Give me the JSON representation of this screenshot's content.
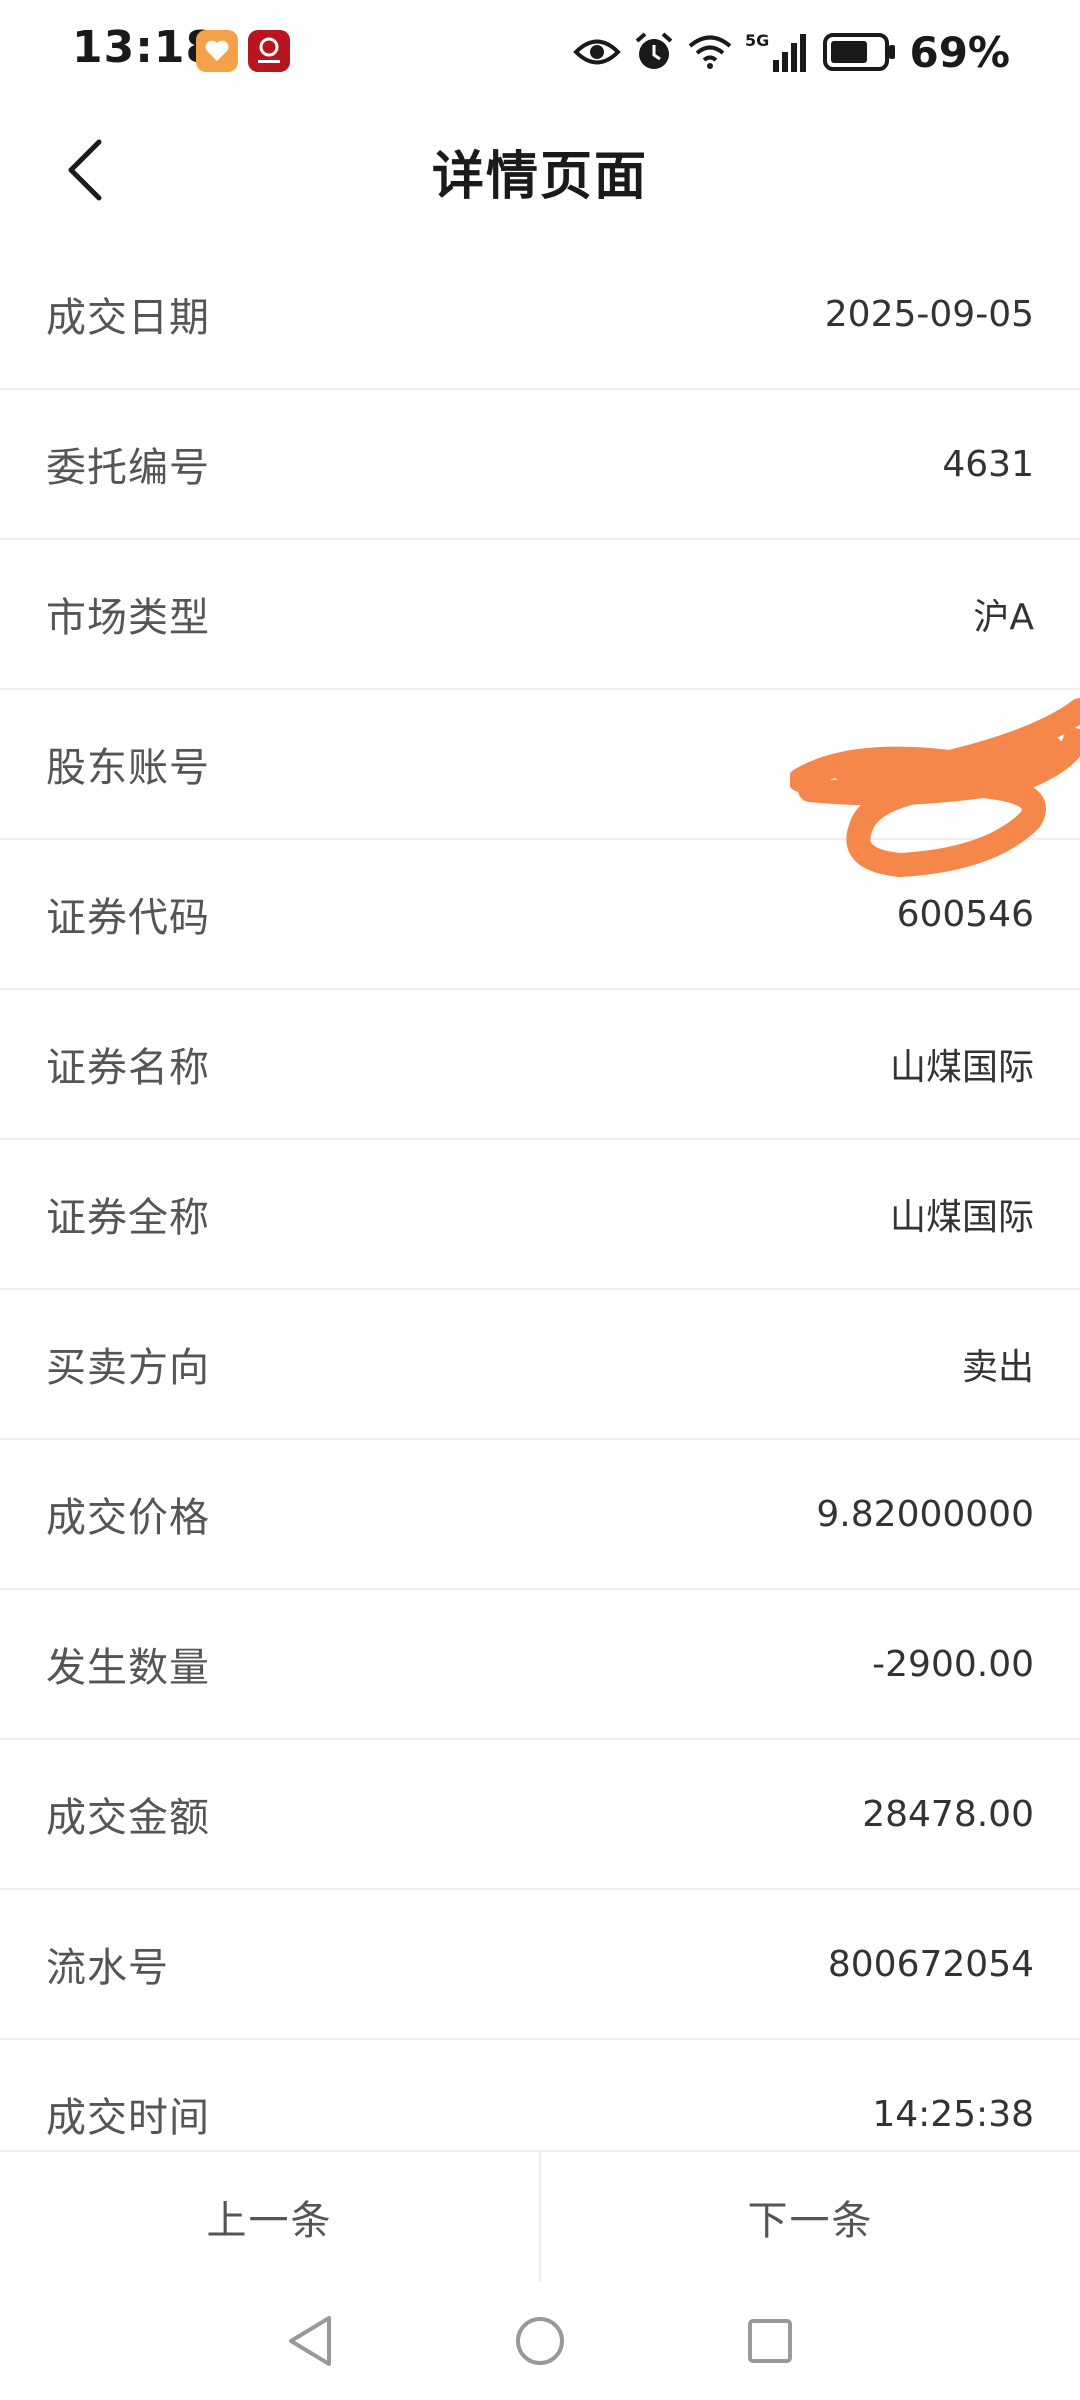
{
  "status_bar": {
    "time": "13:18",
    "battery_percent": "69%",
    "network": "5G",
    "icons": [
      "eye-icon",
      "alarm-icon",
      "wifi-icon",
      "signal-icon",
      "battery-icon"
    ],
    "battery_level": 0.69
  },
  "header": {
    "title": "详情页面",
    "back_icon": "chevron-left-icon"
  },
  "details": [
    {
      "label": "成交日期",
      "value": "2025-09-05"
    },
    {
      "label": "委托编号",
      "value": "4631"
    },
    {
      "label": "市场类型",
      "value": "沪A"
    },
    {
      "label": "股东账号",
      "value": ""
    },
    {
      "label": "证券代码",
      "value": "600546"
    },
    {
      "label": "证券名称",
      "value": "山煤国际"
    },
    {
      "label": "证券全称",
      "value": "山煤国际"
    },
    {
      "label": "买卖方向",
      "value": "卖出"
    },
    {
      "label": "成交价格",
      "value": "9.82000000"
    },
    {
      "label": "发生数量",
      "value": "-2900.00"
    },
    {
      "label": "成交金额",
      "value": "28478.00"
    },
    {
      "label": "流水号",
      "value": "800672054"
    },
    {
      "label": "成交时间",
      "value": "14:25:38"
    }
  ],
  "bottom_bar": {
    "prev_label": "上一条",
    "next_label": "下一条"
  },
  "colors": {
    "redaction": "#f5874a",
    "divider": "#eeeeee",
    "text_primary": "#1a1a1a"
  }
}
